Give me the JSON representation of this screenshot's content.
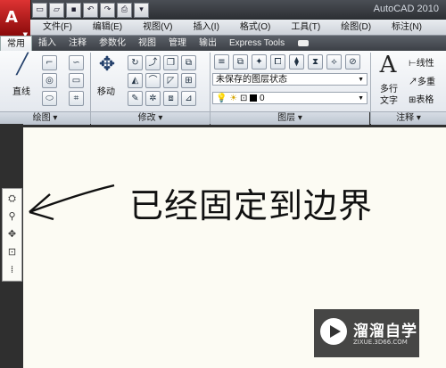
{
  "app": {
    "title": "AutoCAD 2010",
    "logo_letter": "A"
  },
  "menus": [
    "文件(F)",
    "编辑(E)",
    "视图(V)",
    "插入(I)",
    "格式(O)",
    "工具(T)",
    "绘图(D)",
    "标注(N)"
  ],
  "tabs": [
    "常用",
    "插入",
    "注释",
    "参数化",
    "视图",
    "管理",
    "输出",
    "Express Tools"
  ],
  "panels": {
    "draw": {
      "title": "绘图",
      "line_label": "直线"
    },
    "modify": {
      "title": "修改",
      "move_label": "移动"
    },
    "layers": {
      "title": "图层",
      "layer_state": "未保存的图层状态",
      "current_layer": "0"
    },
    "annotation": {
      "title": "注释",
      "mtext_label_1": "多行",
      "mtext_label_2": "文字",
      "linear_label": "线性",
      "multileader_label": "多重",
      "table_label": "表格"
    }
  },
  "canvas": {
    "note": "已经固定到边界"
  },
  "watermark": {
    "title": "溜溜自学",
    "url": "ZIXUE.3D66.COM"
  },
  "colors": {
    "app_red": "#c41a1a",
    "canvas_bg": "#fcfbf3",
    "dark_frame": "#2f2f2f"
  }
}
